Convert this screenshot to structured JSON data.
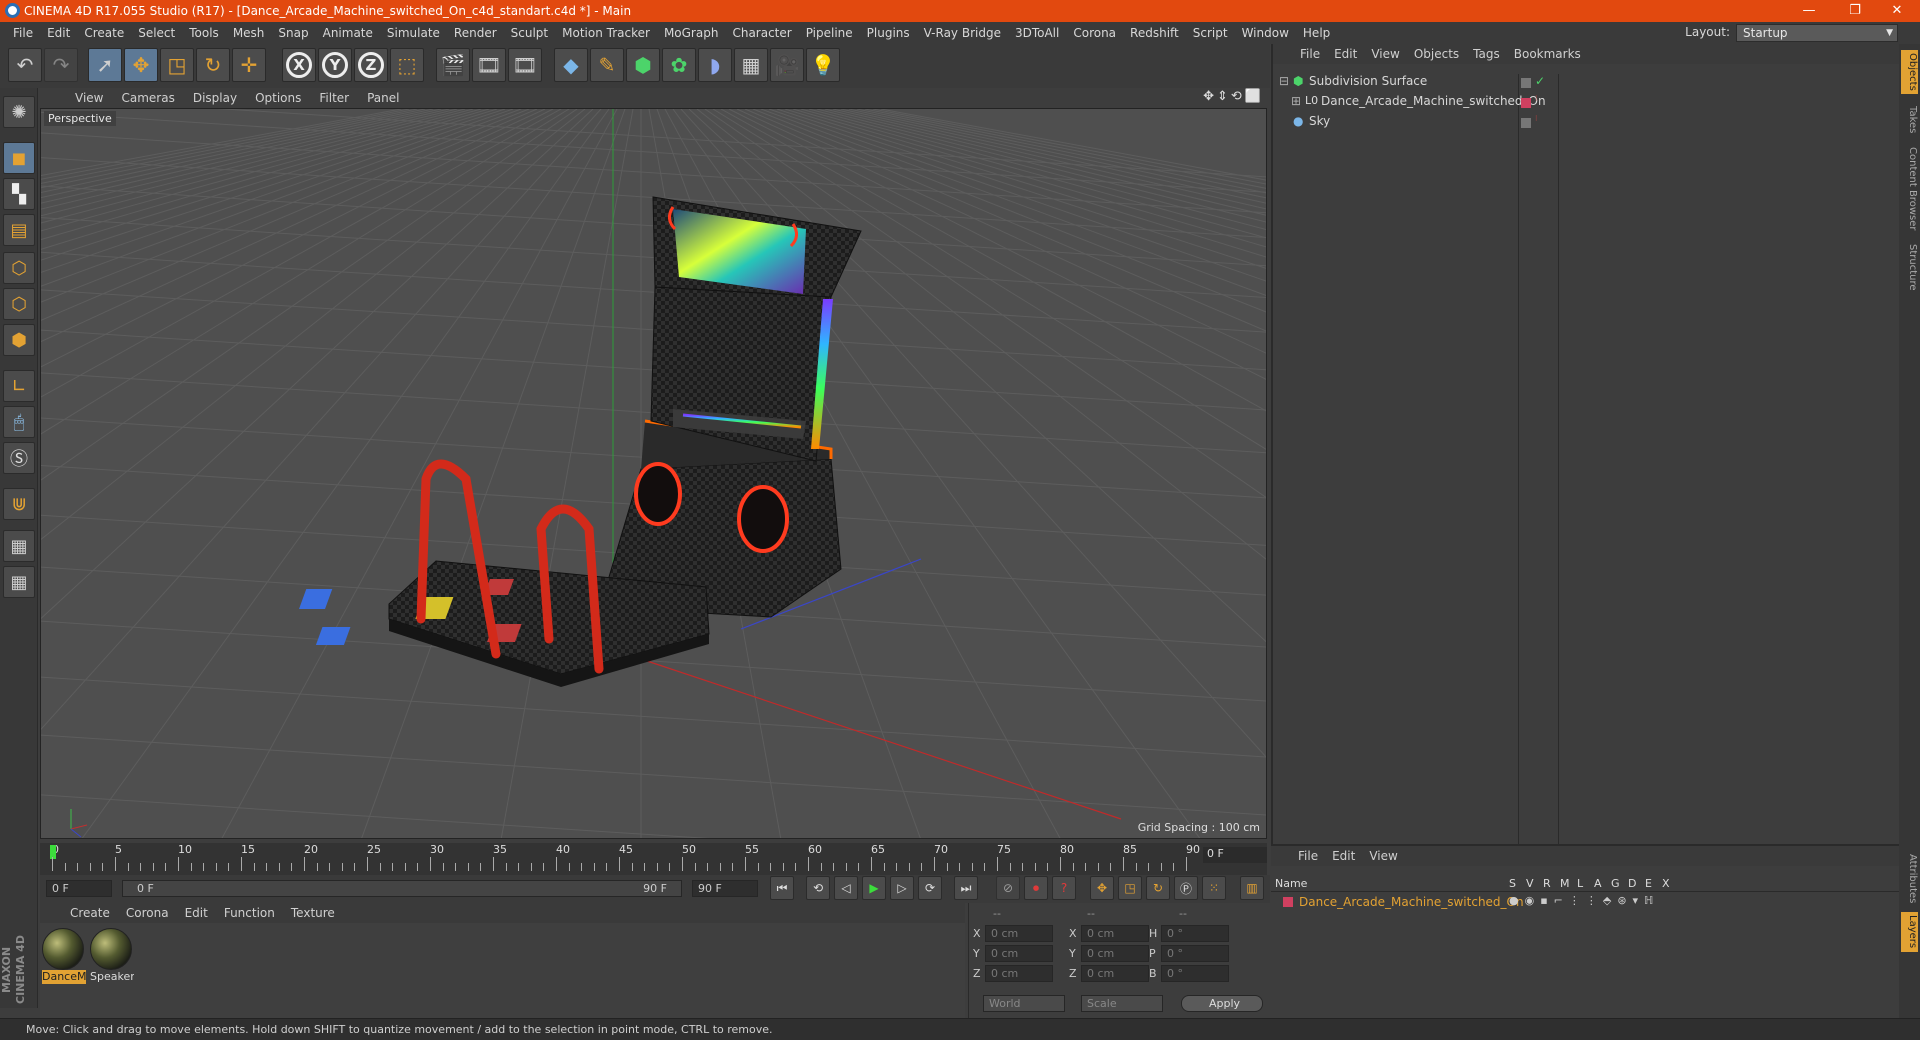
{
  "window": {
    "title": "CINEMA 4D R17.055 Studio (R17) - [Dance_Arcade_Machine_switched_On_c4d_standart.c4d *] - Main",
    "minimize": "—",
    "restore": "❐",
    "close": "✕"
  },
  "menubar": {
    "items": [
      "File",
      "Edit",
      "Create",
      "Select",
      "Tools",
      "Mesh",
      "Snap",
      "Animate",
      "Simulate",
      "Render",
      "Sculpt",
      "Motion Tracker",
      "MoGraph",
      "Character",
      "Pipeline",
      "Plugins",
      "V-Ray Bridge",
      "3DToAll",
      "Corona",
      "Redshift",
      "Script",
      "Window",
      "Help"
    ]
  },
  "layout": {
    "label": "Layout:",
    "value": "Startup"
  },
  "toolbar": {
    "axis_x": "X",
    "axis_y": "Y",
    "axis_z": "Z"
  },
  "viewport": {
    "menu": [
      "View",
      "Cameras",
      "Display",
      "Options",
      "Filter",
      "Panel"
    ],
    "label": "Perspective",
    "grid_spacing": "Grid Spacing : 100 cm"
  },
  "objects_panel": {
    "menu": [
      "File",
      "Edit",
      "View",
      "Objects",
      "Tags",
      "Bookmarks"
    ],
    "items": [
      {
        "name": "Subdivision Surface",
        "icon": "subdivision-icon"
      },
      {
        "name": "Dance_Arcade_Machine_switched_On",
        "icon": "null-object-icon"
      },
      {
        "name": "Sky",
        "icon": "sky-icon"
      }
    ]
  },
  "right_tabs": [
    "Objects",
    "Takes",
    "Content Browser",
    "Structure"
  ],
  "right_tabs_bottom": [
    "Attributes",
    "Layers"
  ],
  "timeline": {
    "ticks": [
      "0",
      "5",
      "10",
      "15",
      "20",
      "25",
      "30",
      "35",
      "40",
      "45",
      "50",
      "55",
      "60",
      "65",
      "70",
      "75",
      "80",
      "85",
      "90"
    ],
    "current_frame": "0 F"
  },
  "transport": {
    "start_field": "0 F",
    "range_start": "0 F",
    "range_end": "90 F",
    "end_field": "90 F"
  },
  "materials": {
    "menu": [
      "Create",
      "Corona",
      "Edit",
      "Function",
      "Texture"
    ],
    "items": [
      {
        "name": "DanceM",
        "selected": true
      },
      {
        "name": "Speaker",
        "selected": false
      }
    ]
  },
  "coordinates": {
    "headers": [
      "--",
      "--",
      "--"
    ],
    "rows": [
      {
        "a": "X",
        "av": "0 cm",
        "b": "X",
        "bv": "0 cm",
        "c": "H",
        "cv": "0 °"
      },
      {
        "a": "Y",
        "av": "0 cm",
        "b": "Y",
        "bv": "0 cm",
        "c": "P",
        "cv": "0 °"
      },
      {
        "a": "Z",
        "av": "0 cm",
        "b": "Z",
        "bv": "0 cm",
        "c": "B",
        "cv": "0 °"
      }
    ],
    "world": "World",
    "scale": "Scale",
    "apply": "Apply"
  },
  "layers_panel": {
    "menu": [
      "File",
      "Edit",
      "View"
    ],
    "columns": [
      "Name",
      "S",
      "V",
      "R",
      "M",
      "L",
      "A",
      "G",
      "D",
      "E",
      "X"
    ],
    "row": "Dance_Arcade_Machine_switched_On"
  },
  "branding": "MAXON CINEMA 4D",
  "status": "Move: Click and drag to move elements. Hold down SHIFT to quantize movement / add to the selection in point mode, CTRL to remove.",
  "colors": {
    "title_bar": "#e2490f",
    "accent": "#e2a233",
    "selection": "#5d7996"
  }
}
